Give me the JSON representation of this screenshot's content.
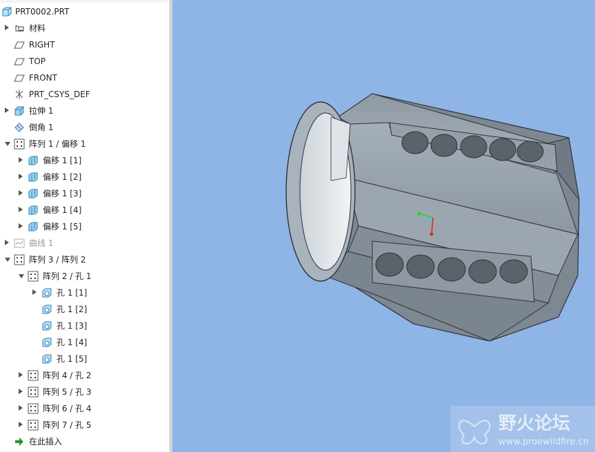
{
  "tree": {
    "items": [
      {
        "label": "PRT0002.PRT",
        "icon": "part-icon",
        "expand": "none",
        "level": 0
      },
      {
        "label": "材料",
        "icon": "material-icon",
        "expand": "right",
        "level": 1
      },
      {
        "label": "RIGHT",
        "icon": "datum-plane-icon",
        "expand": "none",
        "level": 1
      },
      {
        "label": "TOP",
        "icon": "datum-plane-icon",
        "expand": "none",
        "level": 1
      },
      {
        "label": "FRONT",
        "icon": "datum-plane-icon",
        "expand": "none",
        "level": 1
      },
      {
        "label": "PRT_CSYS_DEF",
        "icon": "csys-icon",
        "expand": "none",
        "level": 1
      },
      {
        "label": "拉伸 1",
        "icon": "extrude-icon",
        "expand": "right",
        "level": 1
      },
      {
        "label": "倒角 1",
        "icon": "chamfer-icon",
        "expand": "none",
        "level": 1
      },
      {
        "label": "阵列 1 / 偏移 1",
        "icon": "pattern-icon",
        "expand": "down",
        "level": 1
      },
      {
        "label": "偏移 1 [1]",
        "icon": "offset-icon",
        "expand": "right",
        "level": 2
      },
      {
        "label": "偏移 1 [2]",
        "icon": "offset-icon",
        "expand": "right",
        "level": 2
      },
      {
        "label": "偏移 1 [3]",
        "icon": "offset-icon",
        "expand": "right",
        "level": 2
      },
      {
        "label": "偏移 1 [4]",
        "icon": "offset-icon",
        "expand": "right",
        "level": 2
      },
      {
        "label": "偏移 1 [5]",
        "icon": "offset-icon",
        "expand": "right",
        "level": 2
      },
      {
        "label": "曲线 1",
        "icon": "curve-icon",
        "expand": "right",
        "level": 1,
        "dim": true
      },
      {
        "label": "阵列 3 / 阵列 2",
        "icon": "pattern-icon",
        "expand": "down",
        "level": 1
      },
      {
        "label": "阵列 2 / 孔 1",
        "icon": "pattern-icon",
        "expand": "down",
        "level": 2
      },
      {
        "label": "孔 1 [1]",
        "icon": "hole-icon",
        "expand": "right",
        "level": 3
      },
      {
        "label": "孔 1 [2]",
        "icon": "hole-icon",
        "expand": "none",
        "level": 3
      },
      {
        "label": "孔 1 [3]",
        "icon": "hole-icon",
        "expand": "none",
        "level": 3
      },
      {
        "label": "孔 1 [4]",
        "icon": "hole-icon",
        "expand": "none",
        "level": 3
      },
      {
        "label": "孔 1 [5]",
        "icon": "hole-icon",
        "expand": "none",
        "level": 3
      },
      {
        "label": "阵列 4 / 孔 2",
        "icon": "pattern-icon",
        "expand": "right",
        "level": 2
      },
      {
        "label": "阵列 5 / 孔 3",
        "icon": "pattern-icon",
        "expand": "right",
        "level": 2
      },
      {
        "label": "阵列 6 / 孔 4",
        "icon": "pattern-icon",
        "expand": "right",
        "level": 2
      },
      {
        "label": "阵列 7 / 孔 5",
        "icon": "pattern-icon",
        "expand": "right",
        "level": 2
      },
      {
        "label": "在此插入",
        "icon": "insert-here-icon",
        "expand": "none",
        "level": 1
      }
    ]
  },
  "watermark": {
    "title": "野火论坛",
    "url": "www.proewildfire.cn"
  },
  "colors": {
    "viewport_bg": "#8fb4e6",
    "model": "#9aa4ae",
    "insert_arrow": "#1e9a2a"
  }
}
